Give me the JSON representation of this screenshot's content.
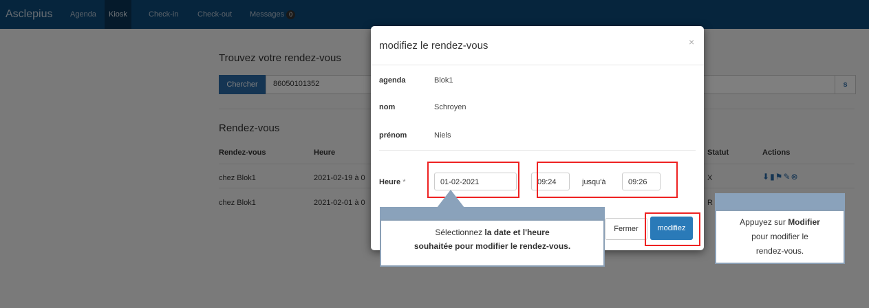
{
  "navbar": {
    "brand": "Asclepius",
    "items": [
      "Agenda",
      "Kiosk",
      "Check-in",
      "Check-out",
      "Messages"
    ],
    "messages_badge": "0"
  },
  "search": {
    "title": "Trouvez votre rendez-vous",
    "button_label": "Chercher",
    "value": "86050101352",
    "side_button": "s"
  },
  "appointments": {
    "title": "Rendez-vous",
    "columns": [
      "Rendez-vous",
      "Heure",
      "Statut",
      "Actions"
    ],
    "rows": [
      {
        "name": "chez Blok1",
        "time": "2021-02-19 à 0",
        "status": "X"
      },
      {
        "name": "chez Blok1",
        "time": "2021-02-01 à 0",
        "status": "R"
      }
    ]
  },
  "modal": {
    "title": "modifiez le rendez-vous",
    "close": "×",
    "fields": [
      {
        "label": "agenda",
        "value": "Blok1"
      },
      {
        "label": "nom",
        "value": "Schroyen"
      },
      {
        "label": "prénom",
        "value": "Niels"
      }
    ],
    "heure_label": "Heure",
    "required_mark": "*",
    "date_value": "01-02-2021",
    "start_time": "09:24",
    "until_label": "jusqu'à",
    "end_time": "09:26",
    "close_button": "Fermer",
    "submit_button": "modifiez"
  },
  "callouts": {
    "left_line1_a": "Sélectionnez ",
    "left_line1_b": "la date et  l'heure",
    "left_line2": "souhaitée pour modifier le rendez-vous.",
    "right_line1_a": "Appuyez sur ",
    "right_line1_b": "Modifier",
    "right_line2": "pour modifier le",
    "right_line3": "rendez-vous."
  },
  "colors": {
    "navbar": "#0d4a7a",
    "primary": "#2a7ab8",
    "highlight": "#e22222",
    "callout_border": "#8aa2bb"
  },
  "icons": [
    "download-icon",
    "trash-icon",
    "flag-icon",
    "edit-icon",
    "cancel-icon"
  ]
}
